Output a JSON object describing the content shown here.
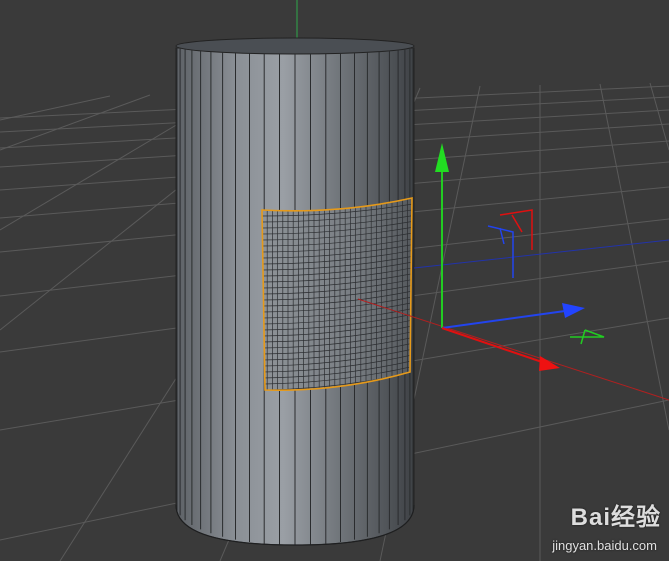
{
  "viewport": {
    "background": "#3a3a3a",
    "grid_color": "#5a5a5a",
    "object": "cylinder",
    "selection": "polygon patch (cylinder front)",
    "selection_color": "#e69a1a"
  },
  "axes": {
    "x_color": "#e01010",
    "y_color": "#22cc22",
    "z_color": "#2244ee"
  },
  "watermark": {
    "brand": "Bai经验",
    "url": "jingyan.baidu.com"
  }
}
